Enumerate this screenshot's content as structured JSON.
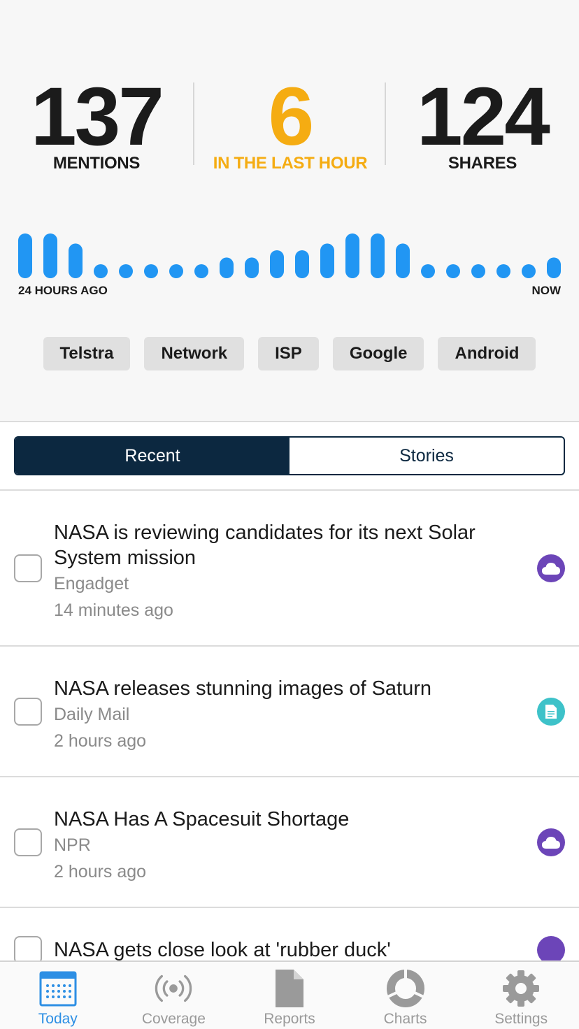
{
  "stats": {
    "mentions": {
      "value": "137",
      "label": "MENTIONS"
    },
    "last_hour": {
      "value": "6",
      "label": "IN THE LAST HOUR"
    },
    "shares": {
      "value": "124",
      "label": "SHARES"
    }
  },
  "colors": {
    "accent_orange": "#f5ac12",
    "bar_blue": "#2196f3",
    "navy": "#0c2840",
    "purple_badge": "#6c45b8",
    "teal_badge": "#3ec2c9",
    "tab_active": "#2d8fe4",
    "tab_inactive": "#9a9a9a"
  },
  "activity": {
    "start_label": "24 HOURS AGO",
    "end_label": "NOW",
    "levels": [
      0.8,
      0.8,
      0.62,
      0.25,
      0.25,
      0.2,
      0.2,
      0.25,
      0.37,
      0.37,
      0.5,
      0.5,
      0.62,
      0.8,
      0.8,
      0.62,
      0.25,
      0.25,
      0.2,
      0.2,
      0.25,
      0.37
    ]
  },
  "tags": [
    "Telstra",
    "Network",
    "ISP",
    "Google",
    "Android"
  ],
  "segments": {
    "recent": "Recent",
    "stories": "Stories",
    "active": "recent"
  },
  "feed": [
    {
      "title": "NASA is reviewing candidates for its next Solar System mission",
      "source": "Engadget",
      "time": "14 minutes ago",
      "icon": "cloud-icon"
    },
    {
      "title": "NASA releases stunning images of Saturn",
      "source": "Daily Mail",
      "time": "2 hours ago",
      "icon": "document-icon"
    },
    {
      "title": "NASA Has A Spacesuit Shortage",
      "source": "NPR",
      "time": "2 hours ago",
      "icon": "cloud-icon"
    },
    {
      "title": "NASA gets close look at 'rubber duck'",
      "source": "",
      "time": "",
      "icon": "cloud-icon"
    }
  ],
  "tabs": [
    {
      "label": "Today",
      "icon": "calendar-icon",
      "active": true
    },
    {
      "label": "Coverage",
      "icon": "broadcast-icon",
      "active": false
    },
    {
      "label": "Reports",
      "icon": "report-icon",
      "active": false
    },
    {
      "label": "Charts",
      "icon": "donut-chart-icon",
      "active": false
    },
    {
      "label": "Settings",
      "icon": "gear-icon",
      "active": false
    }
  ]
}
